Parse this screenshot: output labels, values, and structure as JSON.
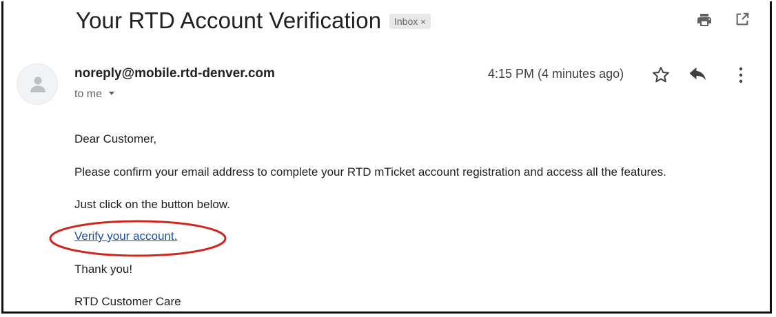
{
  "email": {
    "subject": "Your RTD Account Verification",
    "label": "Inbox",
    "label_close": "×",
    "sender": "noreply@mobile.rtd-denver.com",
    "recipient": "to me",
    "timestamp": "4:15 PM (4 minutes ago)",
    "body": {
      "greeting": "Dear Customer,",
      "paragraph1": "Please confirm your email address to complete your RTD mTicket account registration and access all the features.",
      "paragraph2": "Just click on the button below.",
      "link_text": "Verify your account.",
      "thanks": "Thank you!",
      "signature": "RTD Customer Care"
    }
  },
  "icons": {
    "toolbar": [
      "print-icon",
      "open-in-new-window-icon"
    ],
    "message_actions": [
      "star-icon",
      "reply-icon",
      "more-options-icon"
    ],
    "avatar": "person-avatar-icon",
    "recipient_details": "chevron-down-icon"
  },
  "colors": {
    "link": "#1a4fa3",
    "annotation": "#d0251c",
    "label_chip_bg": "#e8e8e8",
    "icon": "#5f6368"
  }
}
